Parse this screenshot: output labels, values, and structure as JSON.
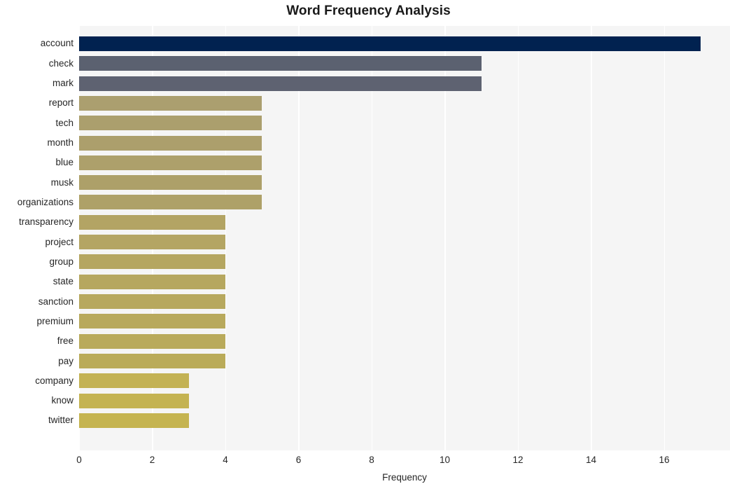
{
  "chart_data": {
    "type": "bar",
    "orientation": "horizontal",
    "title": "Word Frequency Analysis",
    "xlabel": "Frequency",
    "ylabel": "",
    "xlim": [
      0,
      17.8
    ],
    "xticks": [
      0,
      2,
      4,
      6,
      8,
      10,
      12,
      14,
      16
    ],
    "grid": "vertical-only",
    "legend": "none",
    "categories": [
      "account",
      "check",
      "mark",
      "report",
      "tech",
      "month",
      "blue",
      "musk",
      "organizations",
      "transparency",
      "project",
      "group",
      "state",
      "sanction",
      "premium",
      "free",
      "pay",
      "company",
      "know",
      "twitter"
    ],
    "values": [
      17,
      11,
      11,
      5,
      5,
      5,
      5,
      5,
      5,
      4,
      4,
      4,
      4,
      4,
      4,
      4,
      4,
      3,
      3,
      3
    ],
    "bar_colors": [
      "#012250",
      "#5b6170",
      "#5e6271",
      "#ab9f6f",
      "#ab9f6d",
      "#ac9f6c",
      "#ada06b",
      "#ada069",
      "#aea168",
      "#b3a464",
      "#b4a563",
      "#b5a661",
      "#b6a75f",
      "#b7a85e",
      "#b8a95c",
      "#b9aa5b",
      "#baab59",
      "#c3b254",
      "#c4b352",
      "#c5b450"
    ],
    "colors": {
      "plot_background": "#f5f5f5",
      "figure_background": "#ffffff",
      "gridline": "#ffffff",
      "text": "#262626",
      "title": "#1a1a1a"
    }
  }
}
